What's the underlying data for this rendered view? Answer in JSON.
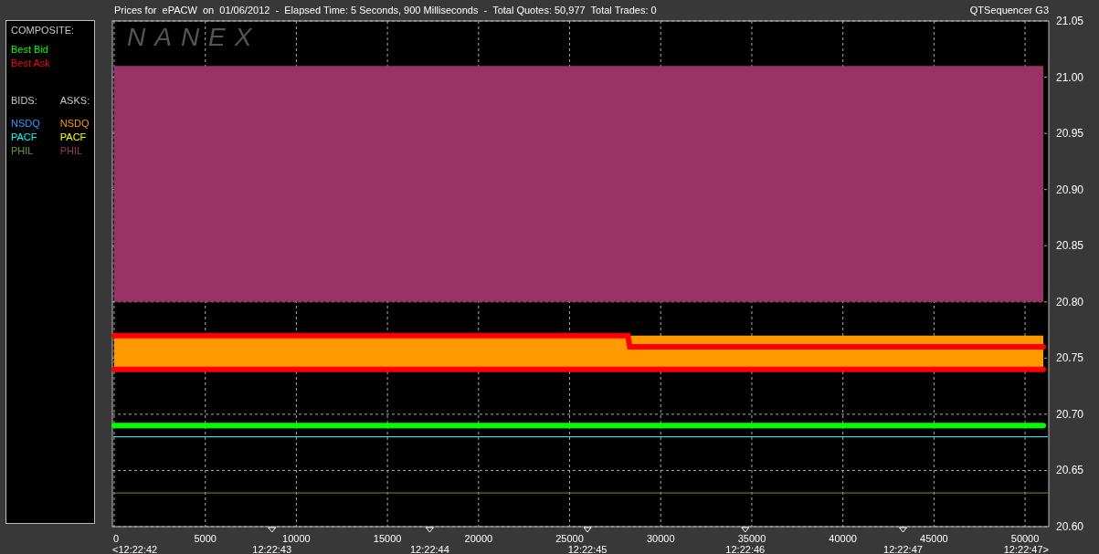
{
  "title_bar": {
    "title": "Prices for  ePACW  on  01/06/2012  -  Elapsed Time: 5 Seconds, 900 Milliseconds  -  Total Quotes: 50,977  Total Trades: 0",
    "app_name": "QTSequencer G3"
  },
  "legend": {
    "composite_heading": "COMPOSITE:",
    "bids_heading": "BIDS:",
    "asks_heading": "ASKS:",
    "bids": [
      {
        "label": "NSDQ",
        "color": "#3399ff"
      },
      {
        "label": "PACF",
        "color": "#00ffff"
      },
      {
        "label": "PHIL",
        "color": "#669933"
      }
    ],
    "asks": [
      {
        "label": "NSDQ",
        "color": "#ff9900"
      },
      {
        "label": "PACF",
        "color": "#ffff00"
      },
      {
        "label": "PHIL",
        "color": "#993366"
      }
    ]
  },
  "chart": {
    "logo": "NANEX",
    "time_axis": [
      "<12:22:42",
      "12:22:43",
      "12:22:44",
      "12:22:45",
      "12:22:46",
      "12:22:47",
      "12:22:47>"
    ],
    "chart_data": {
      "type": "line",
      "xlim": [
        0,
        51300
      ],
      "ylim": [
        20.6,
        21.05
      ],
      "xticks": [
        0,
        5000,
        10000,
        15000,
        20000,
        25000,
        30000,
        35000,
        40000,
        45000,
        50000
      ],
      "yticks": [
        {
          "value": 20.6,
          "label": "20.60"
        },
        {
          "value": 20.65,
          "label": "20.65"
        },
        {
          "value": 20.7,
          "label": "20.70"
        },
        {
          "value": 20.75,
          "label": "20.75"
        },
        {
          "value": 20.8,
          "label": "20.80"
        },
        {
          "value": 20.85,
          "label": "20.85"
        },
        {
          "value": 20.9,
          "label": "20.90"
        },
        {
          "value": 20.95,
          "label": "20.95"
        },
        {
          "value": 21.0,
          "label": "21.00"
        },
        {
          "value": 21.05,
          "label": "21.05"
        }
      ],
      "grid": true,
      "x": [
        0,
        28200,
        28300,
        51000
      ],
      "bands": [
        {
          "axis": "y",
          "from": 20.8,
          "to": 21.01,
          "color": "#993366"
        },
        {
          "axis": "y",
          "from": 20.74,
          "to": 20.77,
          "color": "#ff9900"
        }
      ],
      "ref_lines": [
        {
          "axis": "y",
          "value": 20.68,
          "color": "#00ffff"
        },
        {
          "axis": "y",
          "value": 20.63,
          "color": "#669933"
        }
      ],
      "series": [
        {
          "name": "Best Bid",
          "color": "#00ff00",
          "values": [
            20.69,
            20.69,
            20.69,
            20.69
          ]
        },
        {
          "name": "Best Ask",
          "color": "#ff0000",
          "values": [
            20.74,
            20.74,
            20.74,
            20.74
          ]
        },
        {
          "color": "#ff0000",
          "values": [
            20.77,
            20.77,
            20.76,
            20.76
          ]
        }
      ]
    }
  }
}
